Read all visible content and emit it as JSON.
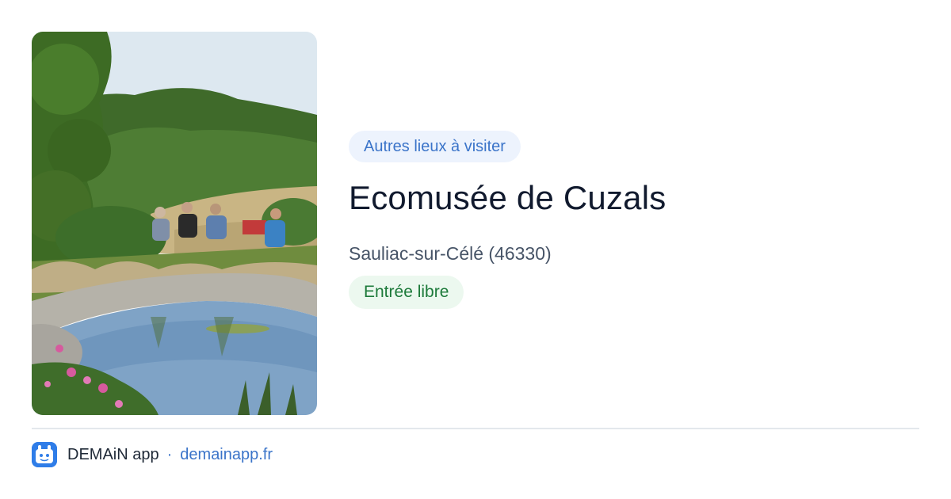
{
  "card": {
    "category": "Autres lieux à visiter",
    "title": "Ecomusée de Cuzals",
    "location": "Sauliac-sur-Célé (46330)",
    "price": "Entrée libre"
  },
  "footer": {
    "app_name": "DEMAiN app",
    "separator": "·",
    "domain": "demainapp.fr"
  },
  "colors": {
    "category_bg": "#edf3fd",
    "category_text": "#3b74c9",
    "price_bg": "#ecf8ef",
    "price_text": "#1d7a3a",
    "link": "#3b74c9",
    "logo": "#2f7de8"
  }
}
